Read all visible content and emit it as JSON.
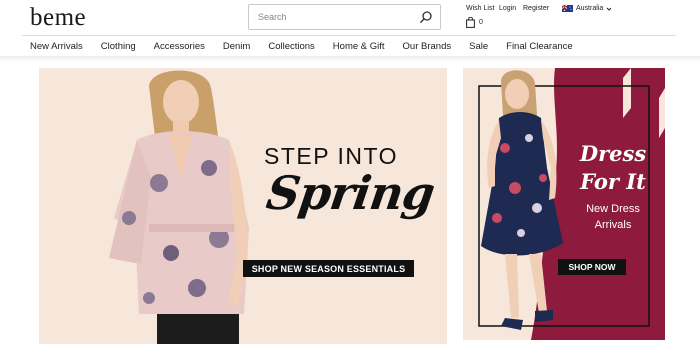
{
  "header": {
    "logo": "beme",
    "search": {
      "placeholder": "Search"
    },
    "utility": {
      "wish_list": "Wish List",
      "login": "Login",
      "register": "Register",
      "country": "Australia"
    },
    "bag_count": "0"
  },
  "nav": {
    "items": [
      {
        "label": "New Arrivals"
      },
      {
        "label": "Clothing"
      },
      {
        "label": "Accessories"
      },
      {
        "label": "Denim"
      },
      {
        "label": "Collections"
      },
      {
        "label": "Home & Gift"
      },
      {
        "label": "Our Brands"
      },
      {
        "label": "Sale"
      },
      {
        "label": "Final Clearance"
      }
    ]
  },
  "hero": {
    "title": "STEP INTO",
    "script": "Spring",
    "cta": "SHOP NEW SEASON ESSENTIALS"
  },
  "side_banner": {
    "script_line1": "Dress",
    "script_line2": "For It",
    "sub_line1": "New Dress",
    "sub_line2": "Arrivals",
    "cta": "SHOP NOW"
  },
  "colors": {
    "banner_bg": "#f6e7da",
    "accent_burgundy": "#8e1a3d",
    "cta_bg": "#111111",
    "text": "#222222"
  },
  "icons": {
    "search": "search-icon",
    "bag": "bag-icon",
    "flag": "australia-flag-icon",
    "dropdown": "chevron-down-icon"
  }
}
